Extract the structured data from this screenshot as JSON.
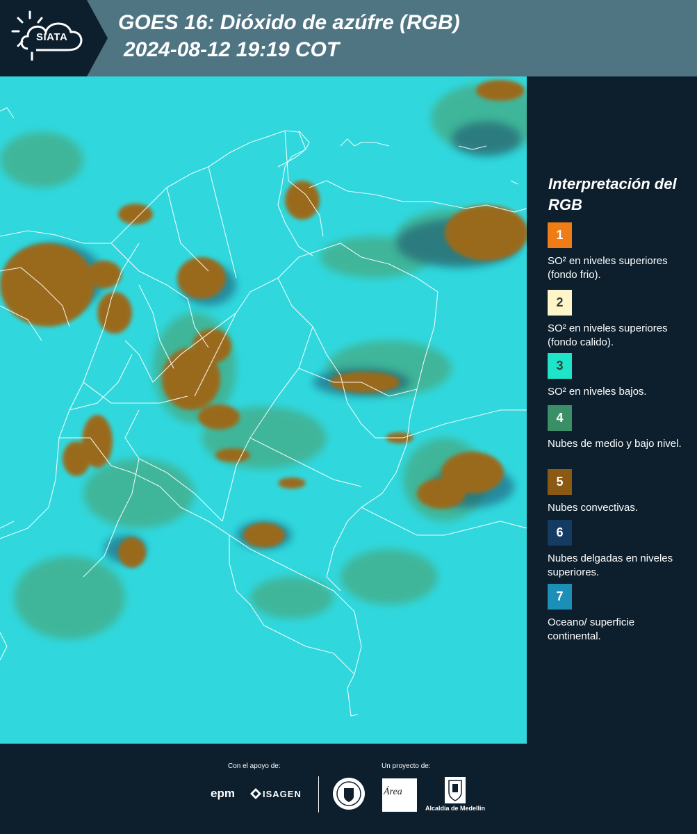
{
  "header": {
    "logo_text": "SIATA",
    "title_line1": "GOES 16: Dióxido de azúfre (RGB)",
    "title_line2": "2024-08-12 19:19 COT"
  },
  "map": {
    "icon": "satellite-rgb-map-colombia",
    "colors": {
      "background": "#2fd7dc",
      "convective": "#9a6a1c",
      "mid_low": "#4e9a62",
      "thin_high": "#1f4d6a",
      "borders": "#ffffff"
    }
  },
  "legend": {
    "title": "Interpretación del RGB",
    "items": [
      {
        "number": "1",
        "color": "#f07c16",
        "text": "SO² en niveles superiores (fondo frio)."
      },
      {
        "number": "2",
        "color": "#fef6c8",
        "text": "SO² en niveles superiores (fondo calido)."
      },
      {
        "number": "3",
        "color": "#1ee5c7",
        "text": "SO² en niveles bajos."
      },
      {
        "number": "4",
        "color": "#3a8f66",
        "text": "Nubes de medio y bajo nivel."
      },
      {
        "number": "5",
        "color": "#8a5a14",
        "text": "Nubes convectivas."
      },
      {
        "number": "6",
        "color": "#163b62",
        "text": "Nubes delgadas en niveles superiores."
      },
      {
        "number": "7",
        "color": "#1b8fb8",
        "text": "Oceano/ superficie continental."
      }
    ]
  },
  "footer": {
    "support_label": "Con el apoyo de:",
    "project_label": "Un proyecto de:",
    "sponsor1": "epm",
    "sponsor2": "ISAGEN",
    "partner_area": "Área",
    "partner_alcaldia": "Alcaldía de Medellín"
  }
}
